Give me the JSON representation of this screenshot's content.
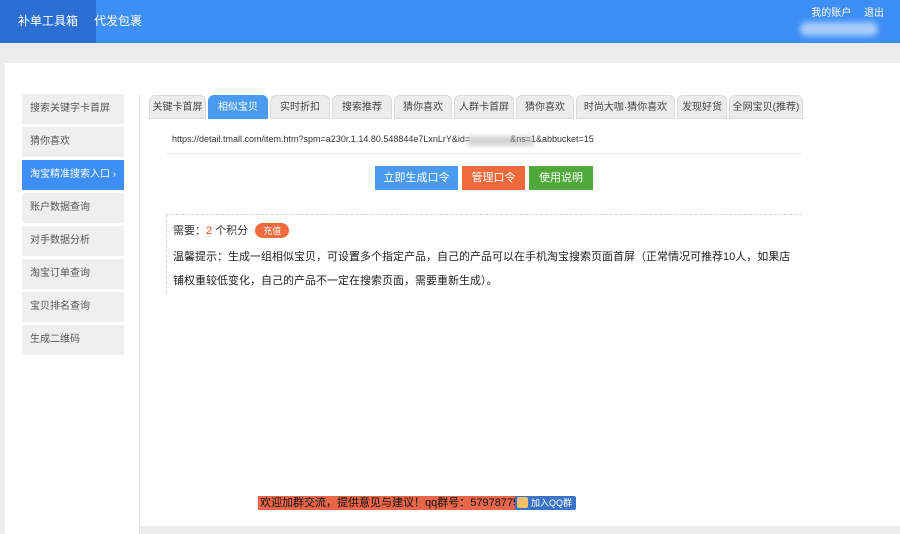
{
  "topbar": {
    "nav": [
      "补单工具箱",
      "代发包裹"
    ],
    "account": "我的账户",
    "logout": "退出"
  },
  "sidebar": {
    "items": [
      "搜索关键字卡首屏",
      "猜你喜欢",
      "淘宝精准搜索入口 ›",
      "账户数据查询",
      "对手数据分析",
      "淘宝订单查询",
      "宝贝排名查询",
      "生成二维码"
    ]
  },
  "tabs": [
    "关键卡首屏",
    "相似宝贝",
    "实时折扣",
    "搜索推荐",
    "猜你喜欢",
    "人群卡首屏",
    "猜你喜欢",
    "时尚大咖·猜你喜欢",
    "发现好货",
    "全网宝贝(推荐)"
  ],
  "url": {
    "value": "https://detail.tmall.com/item.htm?spm=a230r.1.14.80.548844e7LxnLrY&id=                &ns=1&abbucket=15"
  },
  "buttons": {
    "generate": "立即生成口令",
    "manage": "管理口令",
    "help": "使用说明"
  },
  "info": {
    "cost_prefix": "需要：",
    "cost_value": "2",
    "cost_suffix": "个积分",
    "recharge": "充值",
    "tip": "温馨提示：生成一组相似宝贝，可设置多个指定产品，自己的产品可以在手机淘宝搜索页面首屏（正常情况可推荐10人，如果店铺权重较低变化，自己的产品不一定在搜索页面，需要重新生成）。"
  },
  "footer": {
    "note": "欢迎加群交流，提供意见与建议！qq群号：579787758",
    "join_group": "加入QQ群"
  }
}
